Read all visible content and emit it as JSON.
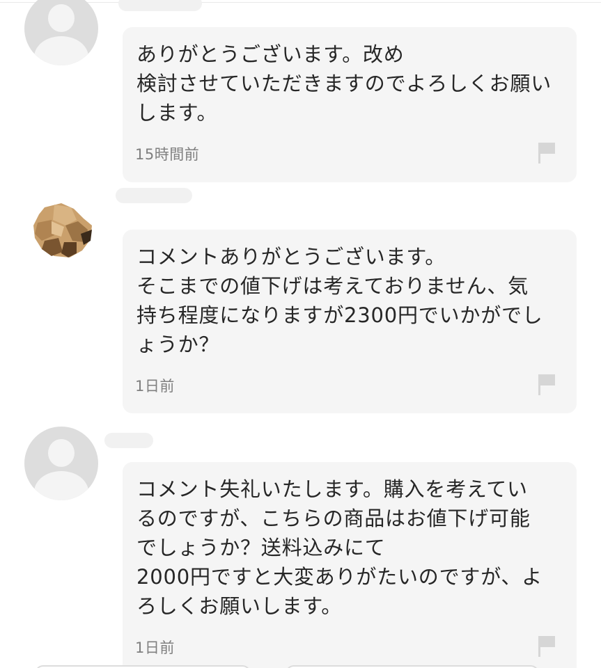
{
  "comments": [
    {
      "avatar": "default-user-icon",
      "lines": [
        "ありがとうございます。改め",
        "検討させていただきますのでよろしくお願い",
        "します。"
      ],
      "time": "15時間前",
      "flag_icon": "flag-icon"
    },
    {
      "avatar": "mosaic-user-avatar",
      "lines": [
        "コメントありがとうございます。",
        "そこまでの値下げは考えておりません、気",
        "持ち程度になりますが2300円でいかがでし",
        "ょうか？"
      ],
      "time": "1日前",
      "flag_icon": "flag-icon"
    },
    {
      "avatar": "default-user-icon",
      "lines": [
        "コメント失礼いたします。購入を考えてい",
        "るのですが、こちらの商品はお値下げ可能",
        "でしょうか？送料込みにて",
        "2000円ですと大変ありがたいのですが、よ",
        "ろしくお願いします。"
      ],
      "time": "1日前",
      "flag_icon": "flag-icon"
    }
  ],
  "colors": {
    "bubble": "#f5f5f5",
    "avatar_default": "#dddddd",
    "time_text": "#7f7f7f",
    "flag": "#d6d6d6"
  }
}
